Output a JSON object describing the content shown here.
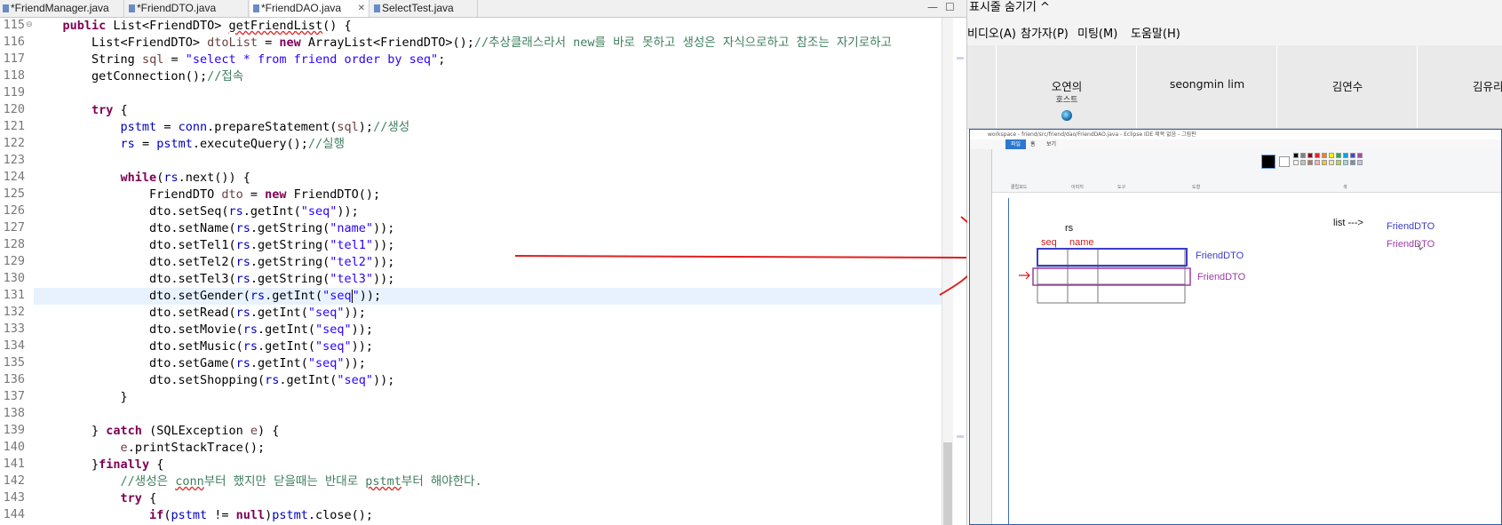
{
  "editor": {
    "tabs": [
      {
        "label": "*FriendManager.java",
        "active": false
      },
      {
        "label": "*FriendDTO.java",
        "active": false
      },
      {
        "label": "*FriendDAO.java",
        "active": true
      },
      {
        "label": "SelectTest.java",
        "active": false
      }
    ],
    "close_glyph": "✕",
    "minimize_glyph": "—",
    "maximize_glyph": "☐",
    "line_numbers": [
      "115",
      "116",
      "117",
      "118",
      "119",
      "120",
      "121",
      "122",
      "123",
      "124",
      "125",
      "126",
      "127",
      "128",
      "129",
      "130",
      "131",
      "132",
      "133",
      "134",
      "135",
      "136",
      "137",
      "138",
      "139",
      "140",
      "141",
      "142",
      "143",
      "144"
    ],
    "current_line": "131",
    "code": {
      "l115_a": "public",
      "l115_b": " List<FriendDTO> ",
      "l115_c": "getFriendList",
      "l115_d": "() {",
      "l116_a": "List<FriendDTO> ",
      "l116_b": "dtoList",
      "l116_c": " = ",
      "l116_d": "new",
      "l116_e": " ArrayList<FriendDTO>();",
      "l116_f": "//추상클래스라서 new를 바로 못하고 생성은 자식으로하고 참조는 자기로하고",
      "l117_a": "String ",
      "l117_b": "sql",
      "l117_c": " = ",
      "l117_d": "\"select * from friend order by seq\"",
      "l117_e": ";",
      "l118_a": "getConnection();",
      "l118_b": "//접속",
      "l120_a": "try",
      "l120_b": " {",
      "l121_a": "pstmt",
      "l121_b": " = ",
      "l121_c": "conn",
      "l121_d": ".prepareStatement(",
      "l121_e": "sql",
      "l121_f": ");",
      "l121_g": "//생성",
      "l122_a": "rs",
      "l122_b": " = ",
      "l122_c": "pstmt",
      "l122_d": ".executeQuery();",
      "l122_e": "//실행",
      "l124_a": "while",
      "l124_b": "(",
      "l124_c": "rs",
      "l124_d": ".next()) {",
      "l125_a": "FriendDTO ",
      "l125_b": "dto",
      "l125_c": " = ",
      "l125_d": "new",
      "l125_e": " FriendDTO();",
      "l126_a": "dto.setSeq(",
      "l126_b": "rs",
      "l126_c": ".getInt(",
      "l126_d": "\"seq\"",
      "l126_e": "));",
      "l127_a": "dto.setName(",
      "l127_b": "rs",
      "l127_c": ".getString(",
      "l127_d": "\"name\"",
      "l127_e": "));",
      "l128_a": "dto.setTel1(",
      "l128_b": "rs",
      "l128_c": ".getString(",
      "l128_d": "\"tel1\"",
      "l128_e": "));",
      "l129_a": "dto.setTel2(",
      "l129_b": "rs",
      "l129_c": ".getString(",
      "l129_d": "\"tel2\"",
      "l129_e": "));",
      "l130_a": "dto.setTel3(",
      "l130_b": "rs",
      "l130_c": ".getString(",
      "l130_d": "\"tel3\"",
      "l130_e": "));",
      "l131_a": "dto.setGender(",
      "l131_b": "rs",
      "l131_c": ".getInt(",
      "l131_d": "\"seq",
      "l131_e": "\"",
      "l131_f": "));",
      "l132_a": "dto.setRead(",
      "l132_b": "rs",
      "l132_c": ".getInt(",
      "l132_d": "\"seq\"",
      "l132_e": "));",
      "l133_a": "dto.setMovie(",
      "l133_b": "rs",
      "l133_c": ".getInt(",
      "l133_d": "\"seq\"",
      "l133_e": "));",
      "l134_a": "dto.setMusic(",
      "l134_b": "rs",
      "l134_c": ".getInt(",
      "l134_d": "\"seq\"",
      "l134_e": "));",
      "l135_a": "dto.setGame(",
      "l135_b": "rs",
      "l135_c": ".getInt(",
      "l135_d": "\"seq\"",
      "l135_e": "));",
      "l136_a": "dto.setShopping(",
      "l136_b": "rs",
      "l136_c": ".getInt(",
      "l136_d": "\"seq\"",
      "l136_e": "));",
      "l137_a": "}",
      "l139_a": "} ",
      "l139_b": "catch",
      "l139_c": " (SQLException ",
      "l139_d": "e",
      "l139_e": ") {",
      "l140_a": "e",
      "l140_b": ".printStackTrace();",
      "l141_a": "}",
      "l141_b": "finally",
      "l141_c": " {",
      "l142_a": "//생성은 ",
      "l142_b": "conn",
      "l142_c": "부터 했지만 닫을때는 반대로 ",
      "l142_d": "pstmt",
      "l142_e": "부터 해야한다.",
      "l143_a": "try",
      "l143_b": " {",
      "l144_a": "if",
      "l144_b": "(",
      "l144_c": "pstmt",
      "l144_d": " != ",
      "l144_e": "null",
      "l144_f": ")",
      "l144_g": "pstmt",
      "l144_h": ".close();"
    }
  },
  "meeting": {
    "top_text": "표시줄 숨기기 ^",
    "menu": [
      "비디오(A)",
      "참가자(P)",
      "미팅(M)",
      "도움말(H)"
    ],
    "participants": [
      {
        "name": "오연의",
        "role": "호스트"
      },
      {
        "name": "seongmin lim",
        "role": ""
      },
      {
        "name": "김연수",
        "role": ""
      },
      {
        "name": "김유리",
        "role": ""
      }
    ],
    "paint": {
      "title": "workspace - friend/src/friend/dao/FriendDAO.java - Eclipse IDE",
      "subtitle": "제목 없음 - 그림판",
      "tabs": [
        "파일",
        "홈",
        "보기"
      ],
      "groups": [
        "클립보드",
        "이미지",
        "도구",
        "도형",
        "색"
      ],
      "swatches": [
        "#000000",
        "#7f7f7f",
        "#880015",
        "#ed1c24",
        "#ff7f27",
        "#fff200",
        "#22b14c",
        "#00a2e8",
        "#3f48cc",
        "#a349a4",
        "#ffffff",
        "#c3c3c3",
        "#b97a57",
        "#ffaec9",
        "#ffc90e",
        "#efe4b0",
        "#b5e61d",
        "#99d9ea",
        "#7092be",
        "#c8bfe7"
      ],
      "canvas": {
        "rs_label": "rs",
        "seq_label": "seq",
        "name_label": "name",
        "list_label": "list --->",
        "dto_top1": "FriendDTO",
        "dto_top2": "FriendDTO",
        "dto_row1": "FriendDTO",
        "dto_row2": "FriendDTO"
      }
    }
  }
}
